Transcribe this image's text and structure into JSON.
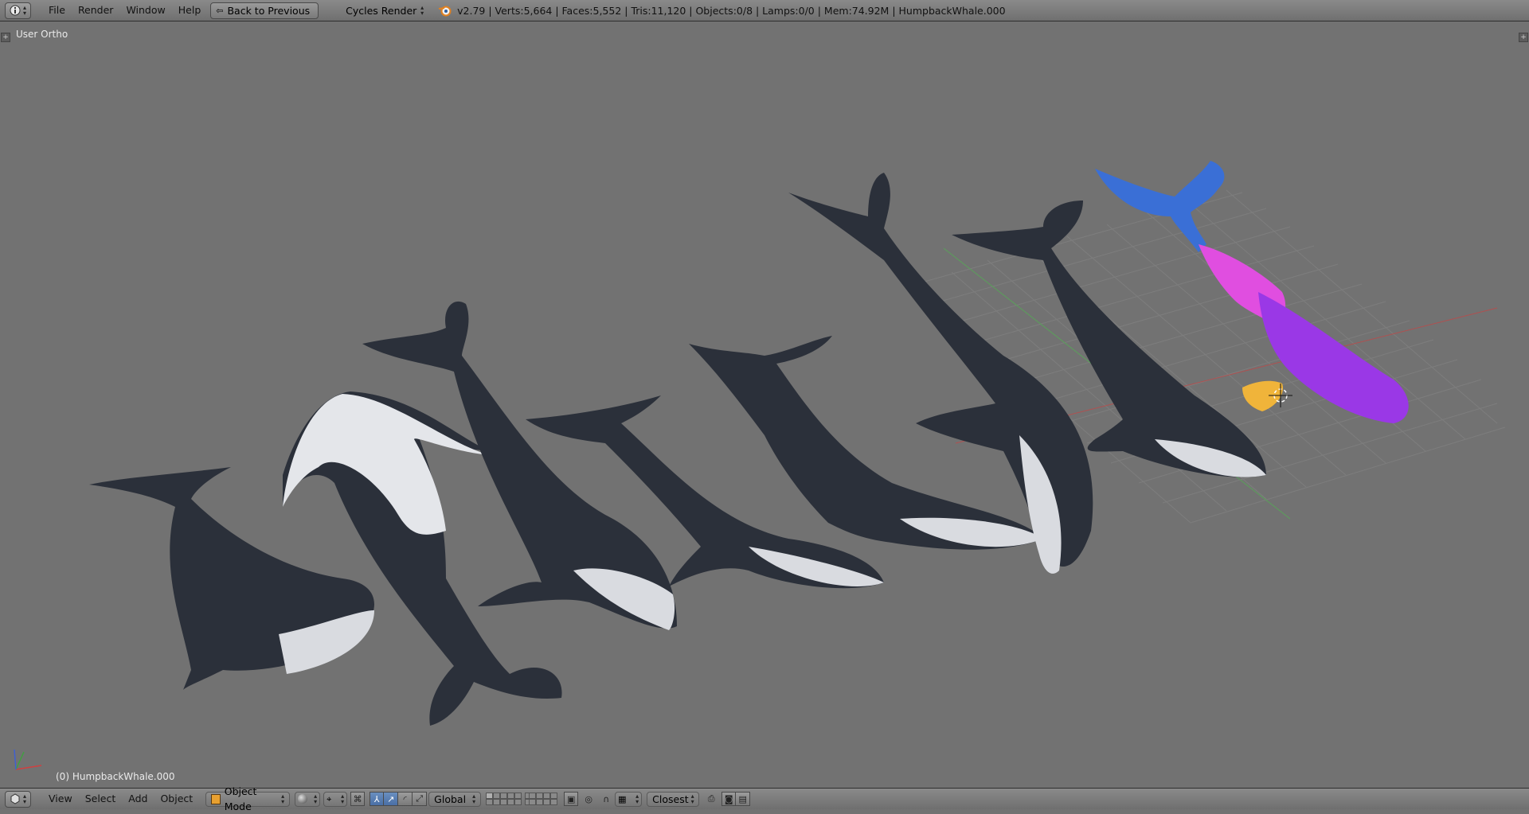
{
  "topbar": {
    "menus": [
      "File",
      "Render",
      "Window",
      "Help"
    ],
    "back_button": "Back to Previous",
    "render_engine": "Cycles Render",
    "stats": "v2.79 | Verts:5,664 | Faces:5,552 | Tris:11,120 | Objects:0/8 | Lamps:0/0 | Mem:74.92M | HumpbackWhale.000"
  },
  "viewport": {
    "view_name": "User Ortho",
    "active_object": "(0) HumpbackWhale.000"
  },
  "bottombar": {
    "menus": [
      "View",
      "Select",
      "Add",
      "Object"
    ],
    "mode": "Object Mode",
    "orientation": "Global",
    "snap_target": "Closest"
  },
  "colors": {
    "viewport_bg": "#727272",
    "header_bg": "#7d7d7d",
    "whale_dark": "#2b303a",
    "whale_light": "#d9dbe0",
    "uv_blue": "#3a6fd6",
    "uv_pink": "#e04ee0",
    "uv_purple": "#9a38e6",
    "uv_yellow": "#f0b43a"
  }
}
